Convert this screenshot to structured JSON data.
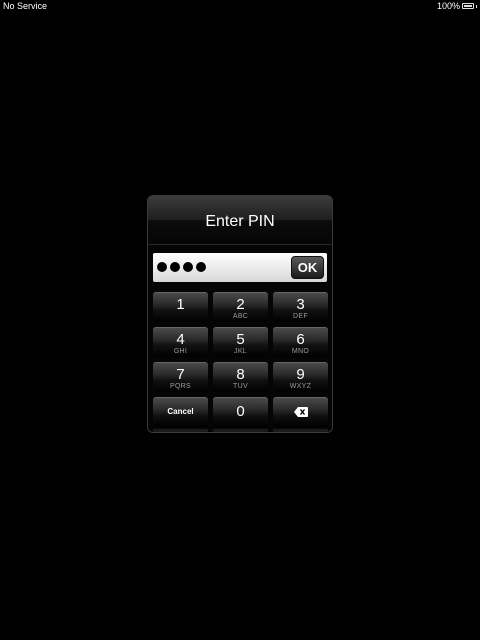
{
  "statusbar": {
    "carrier": "No Service",
    "battery_percent": "100%"
  },
  "dialog": {
    "title": "Enter PIN",
    "pin_digits_entered": 4,
    "ok_label": "OK"
  },
  "keypad": {
    "keys": [
      {
        "num": "1",
        "letters": ""
      },
      {
        "num": "2",
        "letters": "ABC"
      },
      {
        "num": "3",
        "letters": "DEF"
      },
      {
        "num": "4",
        "letters": "GHI"
      },
      {
        "num": "5",
        "letters": "JKL"
      },
      {
        "num": "6",
        "letters": "MNO"
      },
      {
        "num": "7",
        "letters": "PQRS"
      },
      {
        "num": "8",
        "letters": "TUV"
      },
      {
        "num": "9",
        "letters": "WXYZ"
      }
    ],
    "cancel_label": "Cancel",
    "zero_label": "0",
    "delete_icon": "backspace-icon"
  }
}
